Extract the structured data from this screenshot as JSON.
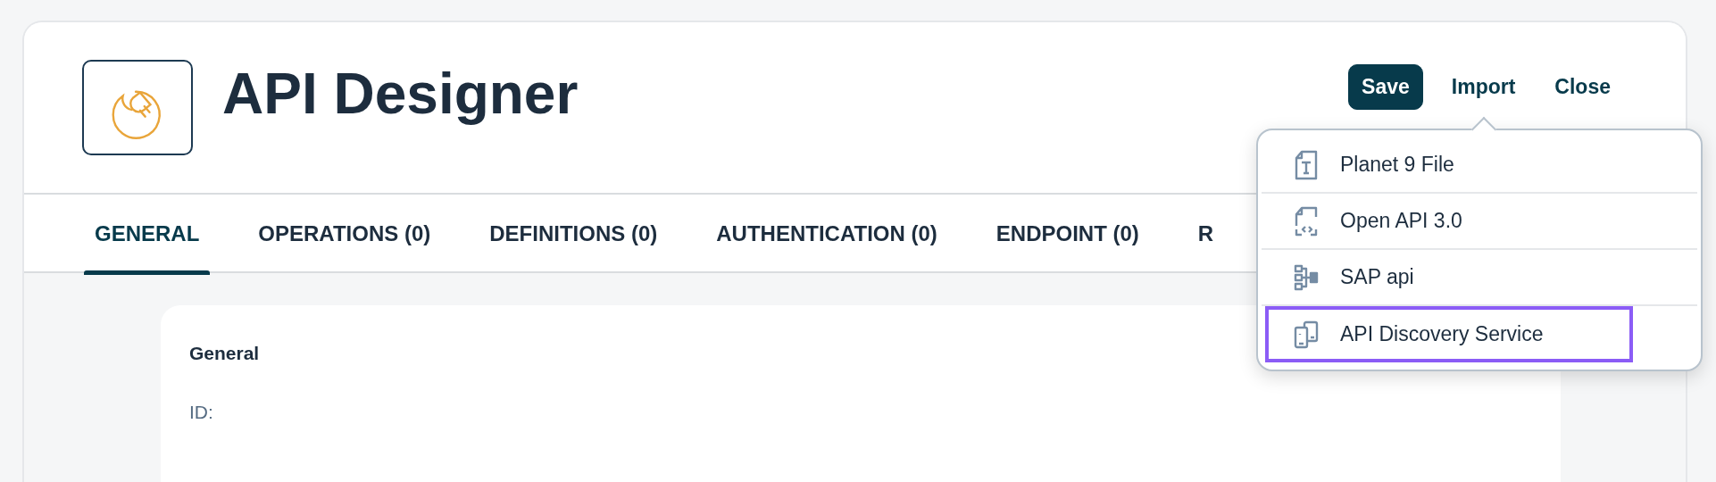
{
  "app": {
    "title": "API Designer"
  },
  "actions": [
    {
      "label": "Save",
      "kind": "primary"
    },
    {
      "label": "Import",
      "kind": "link"
    },
    {
      "label": "Close",
      "kind": "link"
    }
  ],
  "import_menu": {
    "items": [
      {
        "label": "Planet 9 File",
        "highlighted": false
      },
      {
        "label": "Open API 3.0",
        "highlighted": false
      },
      {
        "label": "SAP api",
        "highlighted": false
      },
      {
        "label": "API Discovery Service",
        "highlighted": true
      }
    ]
  },
  "tabs": [
    {
      "label": "GENERAL",
      "selected": true
    },
    {
      "label": "OPERATIONS (0)",
      "selected": false
    },
    {
      "label": "DEFINITIONS (0)",
      "selected": false
    },
    {
      "label": "AUTHENTICATION (0)",
      "selected": false
    },
    {
      "label": "ENDPOINT (0)",
      "selected": false
    },
    {
      "label": "R",
      "selected": false
    }
  ],
  "section": {
    "title": "General",
    "fields": [
      {
        "label": "ID:"
      }
    ]
  }
}
